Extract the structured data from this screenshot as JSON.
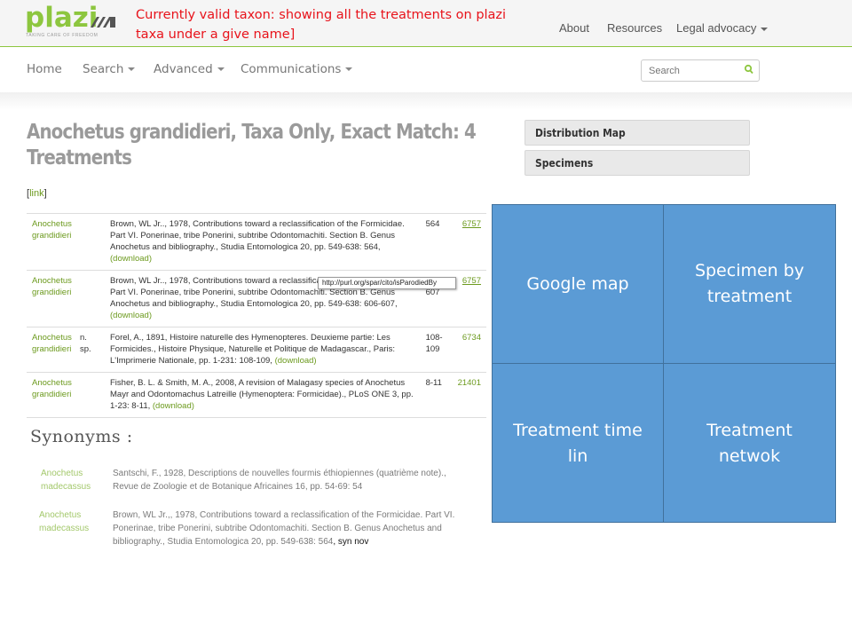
{
  "logo": {
    "word": "plazi",
    "tagline": "TAKING CARE OF FREEDOM"
  },
  "annotation": "Currently valid taxon: showing all the treatments on plazi taxa under a give name]",
  "top_nav": {
    "about": "About",
    "resources": "Resources",
    "legal": "Legal advocacy"
  },
  "sub_nav": {
    "home": "Home",
    "search": "Search",
    "advanced": "Advanced",
    "communications": "Communications"
  },
  "search": {
    "placeholder": "Search"
  },
  "page_title": "Anochetus grandidieri, Taxa Only, Exact Match: 4 Treatments",
  "link_label": "link",
  "side_buttons": {
    "distribution_map": "Distribution Map",
    "specimens": "Specimens"
  },
  "treatments": [
    {
      "taxon": "Anochetus grandidieri",
      "status": "",
      "reference": "Brown, WL Jr.., 1978, Contributions toward a reclassification of the Formicidae. Part VI. Ponerinae, tribe Ponerini, subtribe Odontomachiti. Section B. Genus Anochetus and bibliography., Studia Entomologica 20, pp. 549-638: 564,",
      "download": "(download)",
      "page": "564",
      "id": "6757"
    },
    {
      "taxon": "Anochetus grandidieri",
      "status": "",
      "reference": "Brown, WL Jr.., 1978, Contributions toward a reclassification of the Formicidae. Part VI. Ponerinae, tribe Ponerini, subtribe Odontomachiti. Section B. Genus Anochetus and bibliography., Studia Entomologica 20, pp. 549-638: 606-607,",
      "download": "(download)",
      "page": "606-607",
      "id": "6757"
    },
    {
      "taxon": "Anochetus grandidieri",
      "status": "n. sp.",
      "reference": "Forel, A., 1891, Histoire naturelle des Hymenopteres. Deuxieme partie: Les Formicides., Histoire Physique, Naturelle et Politique de Madagascar., Paris: L'Imprimerie Nationale, pp. 1-231: 108-109,",
      "download": "(download)",
      "page": "108-109",
      "id": "6734"
    },
    {
      "taxon": "Anochetus grandidieri",
      "status": "",
      "reference": "Fisher, B. L. & Smith, M. A., 2008, A revision of Malagasy species of Anochetus Mayr and Odontomachus Latreille (Hymenoptera: Formicidae)., PLoS ONE 3, pp. 1-23: 8-11,",
      "download": "(download)",
      "page": "8-11",
      "id": "21401"
    }
  ],
  "tooltip": "http://purl.org/spar/cito/isParodiedBy",
  "synonyms": {
    "heading": "Synonyms :",
    "rows": [
      {
        "taxon": "Anochetus madecassus",
        "reference": "Santschi, F., 1928, Descriptions de nouvelles fourmis éthiopiennes (quatrième note)., Revue de Zoologie et de Botanique Africaines 16, pp. 54-69: 54",
        "suffix": ""
      },
      {
        "taxon": "Anochetus madecassus",
        "reference": "Brown, WL Jr.,, 1978, Contributions toward a reclassification of the Formicidae. Part VI. Ponerinae, tribe Ponerini, subtribe Odontomachiti. Section B. Genus Anochetus and bibliography., Studia Entomologica 20, pp. 549-638: 564",
        "suffix": ", syn nov"
      }
    ]
  },
  "grid": {
    "google_map": "Google map",
    "specimen_by_treatment": "Specimen by treatment",
    "treatment_timeline": "Treatment time lin",
    "treatment_network": "Treatment netwok"
  },
  "colors": {
    "brand_green": "#8dc63f",
    "annotation_red": "#e8131b",
    "grid_blue": "#5b9bd5",
    "link_green": "#6c9a1e"
  }
}
